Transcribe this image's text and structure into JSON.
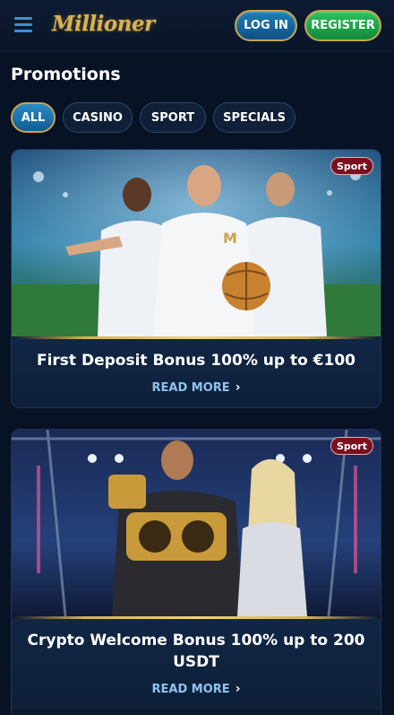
{
  "header": {
    "logo_text": "Millioner",
    "login_label": "LOG IN",
    "register_label": "REGISTER"
  },
  "page_title": "Promotions",
  "filters": [
    {
      "label": "ALL",
      "active": true
    },
    {
      "label": "CASINO",
      "active": false
    },
    {
      "label": "SPORT",
      "active": false
    },
    {
      "label": "SPECIALS",
      "active": false
    }
  ],
  "promotions": [
    {
      "badge": "Sport",
      "title": "First Deposit Bonus 100% up to €100",
      "cta": "READ MORE",
      "image": "three-football-players-in-white-M-jerseys-stadium"
    },
    {
      "badge": "Sport",
      "title": "Crypto Welcome Bonus 100% up to 200 USDT",
      "cta": "READ MORE",
      "image": "fighter-with-championship-belts-and-woman-in-arena"
    }
  ],
  "colors": {
    "background": "#071224",
    "accent_gold": "#c9a34d",
    "login_blue": "#1e7fb5",
    "register_green": "#2ec25c",
    "badge_red": "#7a1020",
    "link_blue": "#8fc3ee"
  }
}
